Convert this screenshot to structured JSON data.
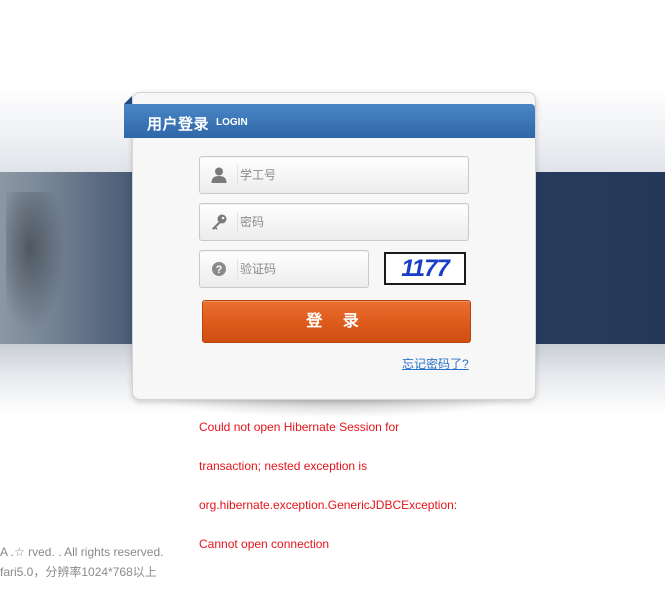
{
  "header": {
    "title": "用户登录",
    "subtitle": "LOGIN"
  },
  "form": {
    "username": {
      "placeholder": "学工号",
      "value": ""
    },
    "password": {
      "placeholder": "密码",
      "value": ""
    },
    "captcha_input": {
      "placeholder": "验证码",
      "value": ""
    },
    "captcha_code": "1177",
    "login_label": "登 录",
    "forgot_label": "忘记密码了?"
  },
  "error_lines": [
    "Could not open Hibernate Session for",
    "transaction; nested exception is",
    "org.hibernate.exception.GenericJDBCException:",
    "Cannot open connection"
  ],
  "footer": {
    "line1": "A .☆ rved. . All rights reserved.",
    "line2": "fari5.0，分辨率1024*768以上"
  },
  "colors": {
    "ribbon": "#2f67a8",
    "login_button": "#dd5a1b",
    "error_text": "#e2141b",
    "link": "#2a73c9",
    "captcha_text": "#1a3fc7"
  },
  "icons": {
    "username": "user-icon",
    "password": "key-icon",
    "captcha": "question-icon"
  }
}
